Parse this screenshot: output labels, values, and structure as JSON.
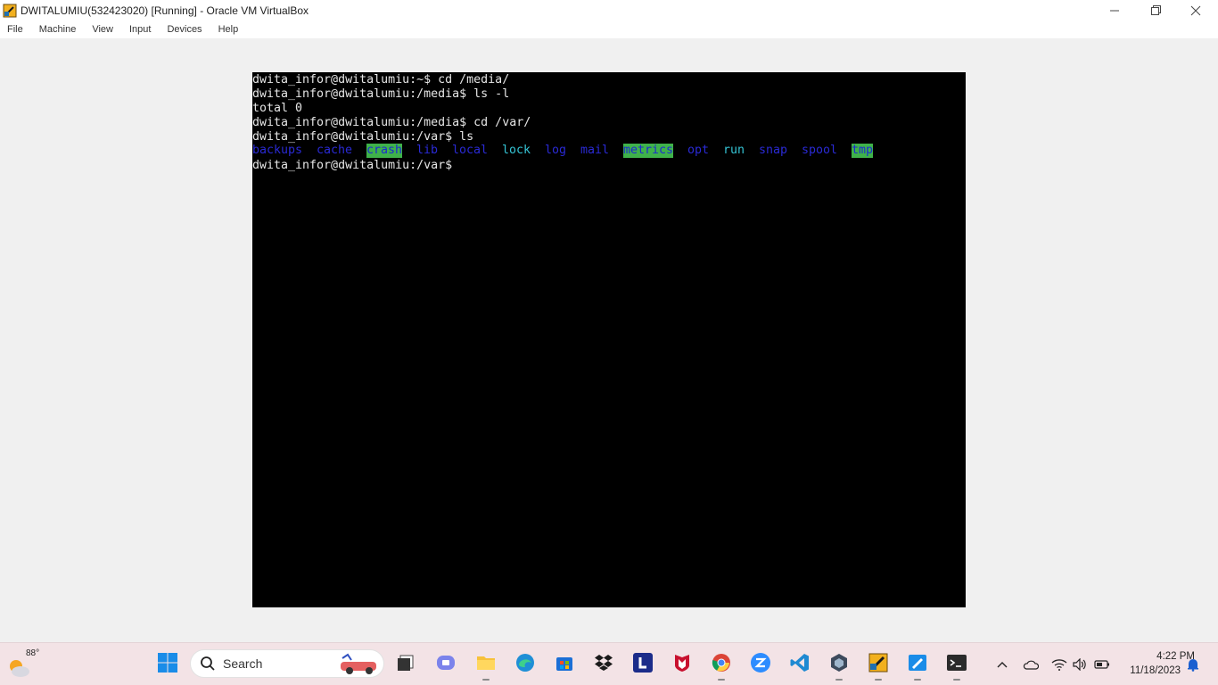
{
  "window": {
    "title": "DWITALUMIU(532423020) [Running] - Oracle VM VirtualBox",
    "controls": [
      "minimize",
      "maximize",
      "close"
    ]
  },
  "menu": {
    "items": [
      "File",
      "Machine",
      "View",
      "Input",
      "Devices",
      "Help"
    ]
  },
  "terminal": {
    "lines": [
      "dwita_infor@dwitalumiu:~$ cd /media/",
      "dwita_infor@dwitalumiu:/media$ ls -l",
      "total 0",
      "dwita_infor@dwitalumiu:/media$ cd /var/",
      "dwita_infor@dwitalumiu:/var$ ls"
    ],
    "ls_output": [
      {
        "name": "backups",
        "color": "#2a2ad6",
        "bg": ""
      },
      {
        "name": "cache",
        "color": "#2a2ad6",
        "bg": ""
      },
      {
        "name": "crash",
        "color": "#1b2bd0",
        "bg": "#3fb24a"
      },
      {
        "name": "lib",
        "color": "#2a2ad6",
        "bg": ""
      },
      {
        "name": "local",
        "color": "#2a2ad6",
        "bg": ""
      },
      {
        "name": "lock",
        "color": "#35c5d6",
        "bg": ""
      },
      {
        "name": "log",
        "color": "#2a2ad6",
        "bg": ""
      },
      {
        "name": "mail",
        "color": "#2a2ad6",
        "bg": ""
      },
      {
        "name": "metrics",
        "color": "#1b2bd0",
        "bg": "#3fb24a"
      },
      {
        "name": "opt",
        "color": "#2a2ad6",
        "bg": ""
      },
      {
        "name": "run",
        "color": "#35c5d6",
        "bg": ""
      },
      {
        "name": "snap",
        "color": "#2a2ad6",
        "bg": ""
      },
      {
        "name": "spool",
        "color": "#2a2ad6",
        "bg": ""
      },
      {
        "name": "tmp",
        "color": "#1b2bd0",
        "bg": "#3fb24a"
      }
    ],
    "prompt": "dwita_infor@dwitalumiu:/var$"
  },
  "taskbar": {
    "weather_temp": "88°",
    "search_placeholder": "Search",
    "apps": [
      "windows-start-icon",
      "task-view-icon",
      "teams-chat-icon",
      "file-explorer-icon",
      "edge-icon",
      "microsoft-store-icon",
      "dropbox-icon",
      "l-app-icon",
      "mcafee-icon",
      "chrome-icon",
      "zoom-icon",
      "vscode-icon",
      "virtualbox-icon",
      "virtualbox-vm-icon",
      "paint-icon",
      "terminal-icon"
    ],
    "clock_time": "4:22 PM",
    "clock_date": "11/18/2023"
  },
  "colors": {
    "taskbar_bg": "#f3e3e6",
    "terminal_bg": "#000000",
    "terminal_fg": "#e6e6e6",
    "dir_blue": "#2a2ad6",
    "symlink_cyan": "#35c5d6",
    "sticky_green_bg": "#3fb24a"
  }
}
